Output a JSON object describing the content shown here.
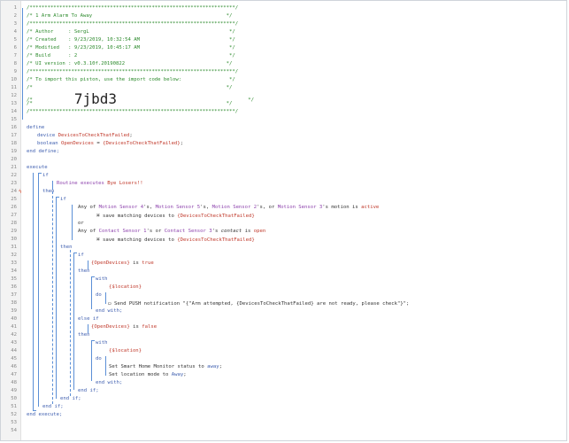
{
  "editor": {
    "line_numbers": [
      "1",
      "2",
      "3",
      "4",
      "5",
      "6",
      "7",
      "8",
      "9",
      "10",
      "11",
      "12",
      "13",
      "14",
      "15",
      "16",
      "17",
      "18",
      "19",
      "20",
      "21",
      "22",
      "23",
      "24",
      "25",
      "26",
      "27",
      "28",
      "29",
      "30",
      "31",
      "32",
      "33",
      "34",
      "35",
      "36",
      "37",
      "38",
      "39",
      "40",
      "41",
      "42",
      "43",
      "44",
      "45",
      "46",
      "47",
      "48",
      "49",
      "50",
      "51",
      "52",
      "53",
      "54"
    ],
    "header": {
      "star_line": "/*********************************************************************/",
      "title": "/* 1 Arm Alarm To Away                                             */",
      "author": "/* Author     : SergL                                               */",
      "created": "/* Created    : 9/23/2019, 10:32:54 AM                              */",
      "modified": "/* Modified   : 9/23/2019, 10:45:17 AM                              */",
      "build": "/* Build      : 2                                                   */",
      "ui_version": "/* UI version : v0.3.10f.20190822                                  */",
      "import_note": "/* To import this piston, use the import code below:                */",
      "blank_comment": "/*                                                                 */",
      "import_code": "7jbd3",
      "import_line_prefix": "/*              ",
      "import_line_suffix": "                                            */"
    },
    "define": {
      "kw": "define",
      "device_kw": "device",
      "device_var": "DevicesToCheckThatFailed",
      "boolean_kw": "boolean",
      "bool_var": "OpenDevices",
      "bool_value": "{DevicesToCheckThatFailed}",
      "end": "end define;"
    },
    "execute": {
      "kw": "execute",
      "if": "if",
      "routine_line": "Routine executes",
      "routine_name": "Bye Losers!!",
      "then": "then",
      "any_of": "Any of",
      "motion_devices": [
        "Motion Sensor 4",
        "Motion Sensor 5",
        "Motion Sensor 2",
        "Motion Sensor 3"
      ],
      "motion_attr": "motion",
      "is": "is",
      "active": "active",
      "save_text": "save matching devices to",
      "save_target": "{DevicesToCheckThatFailed}",
      "or": "or",
      "contact_devices": [
        "Contact Sensor 1",
        "Contact Sensor 3"
      ],
      "contact_attr": "contact",
      "open": "open",
      "open_devices_expr": "{OpenDevices}",
      "true_val": "true",
      "false_val": "false",
      "with": "with",
      "location": "{$location}",
      "do": "do",
      "push_prefix": "Send PUSH notification",
      "push_message": "\"{\"Arm attempted, {DevicesToCheckThatFailed} are not ready, please check\"}\";",
      "end_with": "end with;",
      "else_if": "else if",
      "shm_prefix": "Set Smart Home Monitor status to",
      "shm_value": "away",
      "mode_prefix": "Set location mode to",
      "mode_value": "Away",
      "end_if": "end if;",
      "end_execute": "end execute;"
    }
  }
}
